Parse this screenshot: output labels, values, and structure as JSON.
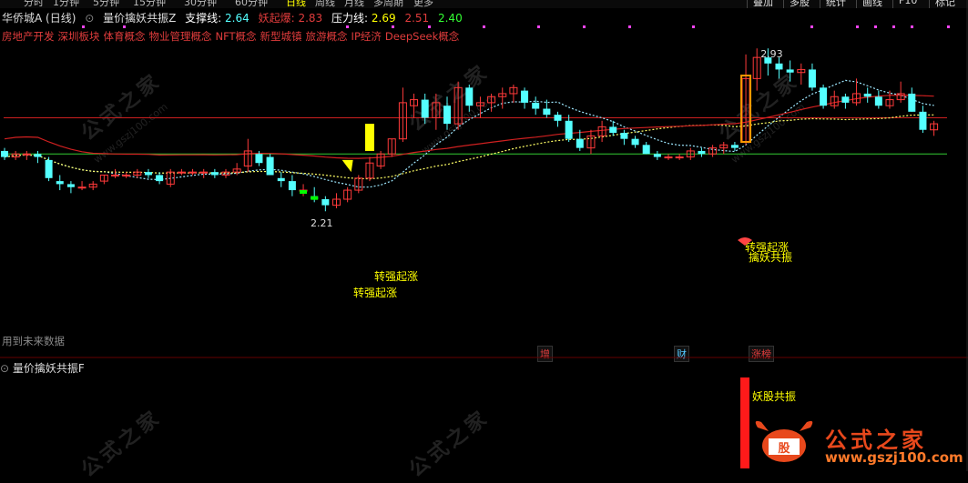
{
  "top_tabs": [
    "分时",
    "1分钟",
    "5分钟",
    "15分钟",
    "30分钟",
    "60分钟",
    "日线",
    "周线",
    "月线",
    "多周期",
    "更多"
  ],
  "top_right_buttons": [
    "叠加",
    "多股",
    "统计",
    "画线",
    "F10",
    "标记"
  ],
  "info": {
    "stock": "华侨城A (日线)",
    "indicator": "量价擒妖共振Z",
    "support_label": "支撑线:",
    "support_value": "2.64",
    "demon_label": "妖起爆:",
    "demon_value": "2.83",
    "pressure_label": "压力线:",
    "pressure_value": "2.69",
    "v1": "2.51",
    "v2": "2.40"
  },
  "concepts": [
    "房地产开发",
    "深圳板块",
    "体育概念",
    "物业管理概念",
    "NFT概念",
    "新型城镇",
    "旅游概念",
    "IP经济",
    "DeepSeek概念"
  ],
  "future_data_hint": "用到未来数据",
  "markers": {
    "add": "增",
    "finance": "财",
    "limit_list": "涨榜"
  },
  "lower_panel": {
    "title": "量价擒妖共振F",
    "signal": "妖股共振"
  },
  "watermark": {
    "cn": "公式之家",
    "url": "www.gszj100.com"
  },
  "logo": {
    "brand": "公式之家",
    "url": "www.gszj100.com"
  },
  "colors": {
    "up": "#ff3a3a",
    "down": "#54ffff",
    "ma_red": "#d02020",
    "support": "#33cc33",
    "resist": "#cc2020",
    "yellow": "#ffff00",
    "green": "#00ff00"
  },
  "chart_data": {
    "type": "candlestick",
    "high_label": "2.93",
    "low_label": "2.21",
    "support": 2.58,
    "resistance": 2.7,
    "ylim": [
      2.05,
      3.0
    ],
    "annotations": [
      "转强起涨",
      "转强起涨",
      "转强起涨",
      "擒妖共振"
    ],
    "candles": [
      {
        "o": 2.59,
        "h": 2.6,
        "l": 2.56,
        "c": 2.57
      },
      {
        "o": 2.57,
        "h": 2.59,
        "l": 2.56,
        "c": 2.58
      },
      {
        "o": 2.58,
        "h": 2.59,
        "l": 2.56,
        "c": 2.58
      },
      {
        "o": 2.58,
        "h": 2.59,
        "l": 2.55,
        "c": 2.57
      },
      {
        "o": 2.56,
        "h": 2.57,
        "l": 2.49,
        "c": 2.5
      },
      {
        "o": 2.49,
        "h": 2.51,
        "l": 2.46,
        "c": 2.48
      },
      {
        "o": 2.48,
        "h": 2.49,
        "l": 2.45,
        "c": 2.47
      },
      {
        "o": 2.47,
        "h": 2.49,
        "l": 2.46,
        "c": 2.47
      },
      {
        "o": 2.47,
        "h": 2.49,
        "l": 2.46,
        "c": 2.48
      },
      {
        "o": 2.49,
        "h": 2.51,
        "l": 2.48,
        "c": 2.51
      },
      {
        "o": 2.51,
        "h": 2.53,
        "l": 2.5,
        "c": 2.51
      },
      {
        "o": 2.51,
        "h": 2.52,
        "l": 2.5,
        "c": 2.51
      },
      {
        "o": 2.51,
        "h": 2.53,
        "l": 2.5,
        "c": 2.52
      },
      {
        "o": 2.52,
        "h": 2.53,
        "l": 2.5,
        "c": 2.51
      },
      {
        "o": 2.51,
        "h": 2.52,
        "l": 2.48,
        "c": 2.49
      },
      {
        "o": 2.48,
        "h": 2.53,
        "l": 2.47,
        "c": 2.52
      },
      {
        "o": 2.52,
        "h": 2.53,
        "l": 2.51,
        "c": 2.52
      },
      {
        "o": 2.52,
        "h": 2.53,
        "l": 2.51,
        "c": 2.52
      },
      {
        "o": 2.52,
        "h": 2.53,
        "l": 2.5,
        "c": 2.52
      },
      {
        "o": 2.52,
        "h": 2.53,
        "l": 2.5,
        "c": 2.51
      },
      {
        "o": 2.51,
        "h": 2.53,
        "l": 2.5,
        "c": 2.52
      },
      {
        "o": 2.52,
        "h": 2.55,
        "l": 2.51,
        "c": 2.53
      },
      {
        "o": 2.54,
        "h": 2.63,
        "l": 2.52,
        "c": 2.59
      },
      {
        "o": 2.58,
        "h": 2.59,
        "l": 2.54,
        "c": 2.55
      },
      {
        "o": 2.57,
        "h": 2.58,
        "l": 2.51,
        "c": 2.51
      },
      {
        "o": 2.5,
        "h": 2.52,
        "l": 2.47,
        "c": 2.49
      },
      {
        "o": 2.49,
        "h": 2.51,
        "l": 2.44,
        "c": 2.46
      },
      {
        "o": 2.46,
        "h": 2.48,
        "l": 2.44,
        "c": 2.46
      },
      {
        "o": 2.44,
        "h": 2.47,
        "l": 2.42,
        "c": 2.43
      },
      {
        "o": 2.43,
        "h": 2.44,
        "l": 2.39,
        "c": 2.41
      },
      {
        "o": 2.41,
        "h": 2.45,
        "l": 2.4,
        "c": 2.43
      },
      {
        "o": 2.43,
        "h": 2.47,
        "l": 2.42,
        "c": 2.46
      },
      {
        "o": 2.46,
        "h": 2.51,
        "l": 2.45,
        "c": 2.5
      },
      {
        "o": 2.5,
        "h": 2.57,
        "l": 2.49,
        "c": 2.55
      },
      {
        "o": 2.54,
        "h": 2.59,
        "l": 2.53,
        "c": 2.58
      },
      {
        "o": 2.58,
        "h": 2.63,
        "l": 2.57,
        "c": 2.63
      },
      {
        "o": 2.63,
        "h": 2.8,
        "l": 2.62,
        "c": 2.75
      },
      {
        "o": 2.74,
        "h": 2.78,
        "l": 2.7,
        "c": 2.76
      },
      {
        "o": 2.76,
        "h": 2.78,
        "l": 2.68,
        "c": 2.7
      },
      {
        "o": 2.7,
        "h": 2.78,
        "l": 2.66,
        "c": 2.75
      },
      {
        "o": 2.74,
        "h": 2.77,
        "l": 2.66,
        "c": 2.68
      },
      {
        "o": 2.68,
        "h": 2.82,
        "l": 2.66,
        "c": 2.8
      },
      {
        "o": 2.8,
        "h": 2.81,
        "l": 2.72,
        "c": 2.74
      },
      {
        "o": 2.74,
        "h": 2.77,
        "l": 2.7,
        "c": 2.75
      },
      {
        "o": 2.75,
        "h": 2.78,
        "l": 2.72,
        "c": 2.77
      },
      {
        "o": 2.77,
        "h": 2.8,
        "l": 2.73,
        "c": 2.78
      },
      {
        "o": 2.78,
        "h": 2.81,
        "l": 2.75,
        "c": 2.8
      },
      {
        "o": 2.79,
        "h": 2.8,
        "l": 2.73,
        "c": 2.75
      },
      {
        "o": 2.75,
        "h": 2.77,
        "l": 2.71,
        "c": 2.73
      },
      {
        "o": 2.73,
        "h": 2.76,
        "l": 2.7,
        "c": 2.71
      },
      {
        "o": 2.71,
        "h": 2.72,
        "l": 2.67,
        "c": 2.69
      },
      {
        "o": 2.69,
        "h": 2.71,
        "l": 2.62,
        "c": 2.63
      },
      {
        "o": 2.63,
        "h": 2.66,
        "l": 2.59,
        "c": 2.6
      },
      {
        "o": 2.6,
        "h": 2.66,
        "l": 2.58,
        "c": 2.64
      },
      {
        "o": 2.64,
        "h": 2.69,
        "l": 2.62,
        "c": 2.67
      },
      {
        "o": 2.67,
        "h": 2.69,
        "l": 2.64,
        "c": 2.65
      },
      {
        "o": 2.65,
        "h": 2.66,
        "l": 2.61,
        "c": 2.63
      },
      {
        "o": 2.63,
        "h": 2.64,
        "l": 2.6,
        "c": 2.61
      },
      {
        "o": 2.61,
        "h": 2.62,
        "l": 2.58,
        "c": 2.58
      },
      {
        "o": 2.58,
        "h": 2.59,
        "l": 2.56,
        "c": 2.57
      },
      {
        "o": 2.57,
        "h": 2.58,
        "l": 2.56,
        "c": 2.57
      },
      {
        "o": 2.57,
        "h": 2.58,
        "l": 2.56,
        "c": 2.57
      },
      {
        "o": 2.57,
        "h": 2.6,
        "l": 2.56,
        "c": 2.59
      },
      {
        "o": 2.59,
        "h": 2.6,
        "l": 2.57,
        "c": 2.58
      },
      {
        "o": 2.58,
        "h": 2.61,
        "l": 2.57,
        "c": 2.6
      },
      {
        "o": 2.6,
        "h": 2.62,
        "l": 2.58,
        "c": 2.61
      },
      {
        "o": 2.61,
        "h": 2.62,
        "l": 2.59,
        "c": 2.6
      },
      {
        "o": 2.62,
        "h": 2.91,
        "l": 2.61,
        "c": 2.83
      },
      {
        "o": 2.83,
        "h": 2.93,
        "l": 2.79,
        "c": 2.9
      },
      {
        "o": 2.9,
        "h": 2.93,
        "l": 2.84,
        "c": 2.88
      },
      {
        "o": 2.88,
        "h": 2.9,
        "l": 2.83,
        "c": 2.86
      },
      {
        "o": 2.86,
        "h": 2.89,
        "l": 2.82,
        "c": 2.85
      },
      {
        "o": 2.85,
        "h": 2.88,
        "l": 2.81,
        "c": 2.86
      },
      {
        "o": 2.86,
        "h": 2.88,
        "l": 2.79,
        "c": 2.8
      },
      {
        "o": 2.8,
        "h": 2.81,
        "l": 2.73,
        "c": 2.74
      },
      {
        "o": 2.74,
        "h": 2.79,
        "l": 2.73,
        "c": 2.77
      },
      {
        "o": 2.77,
        "h": 2.78,
        "l": 2.73,
        "c": 2.75
      },
      {
        "o": 2.75,
        "h": 2.83,
        "l": 2.74,
        "c": 2.78
      },
      {
        "o": 2.78,
        "h": 2.8,
        "l": 2.75,
        "c": 2.77
      },
      {
        "o": 2.77,
        "h": 2.79,
        "l": 2.73,
        "c": 2.74
      },
      {
        "o": 2.74,
        "h": 2.79,
        "l": 2.73,
        "c": 2.76
      },
      {
        "o": 2.76,
        "h": 2.82,
        "l": 2.75,
        "c": 2.78
      },
      {
        "o": 2.78,
        "h": 2.8,
        "l": 2.72,
        "c": 2.72
      },
      {
        "o": 2.72,
        "h": 2.74,
        "l": 2.65,
        "c": 2.66
      },
      {
        "o": 2.66,
        "h": 2.69,
        "l": 2.64,
        "c": 2.68
      }
    ]
  }
}
